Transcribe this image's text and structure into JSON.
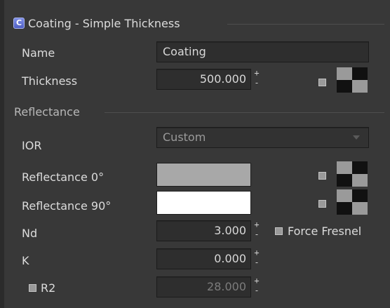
{
  "section": {
    "icon": "coating-icon",
    "title": "Coating - Simple Thickness"
  },
  "name": {
    "label": "Name",
    "value": "Coating"
  },
  "thickness": {
    "label": "Thickness",
    "value": "500.000"
  },
  "reflectance_group": {
    "title": "Reflectance"
  },
  "ior": {
    "label": "IOR",
    "selected": "Custom"
  },
  "reflectance0": {
    "label": "Reflectance 0°",
    "color": "#a8a8a8"
  },
  "reflectance90": {
    "label": "Reflectance 90°",
    "color": "#ffffff"
  },
  "nd": {
    "label": "Nd",
    "value": "3.000"
  },
  "force_fresnel": {
    "label": "Force Fresnel",
    "checked": false
  },
  "k": {
    "label": "K",
    "value": "0.000"
  },
  "r2": {
    "label": "R2",
    "value": "28.000",
    "checked": false
  },
  "spinner": {
    "plus": "+",
    "minus": "-"
  },
  "colors": {
    "accent": "#6a7ad8",
    "panel": "#383838",
    "field": "#2e2e2e"
  }
}
